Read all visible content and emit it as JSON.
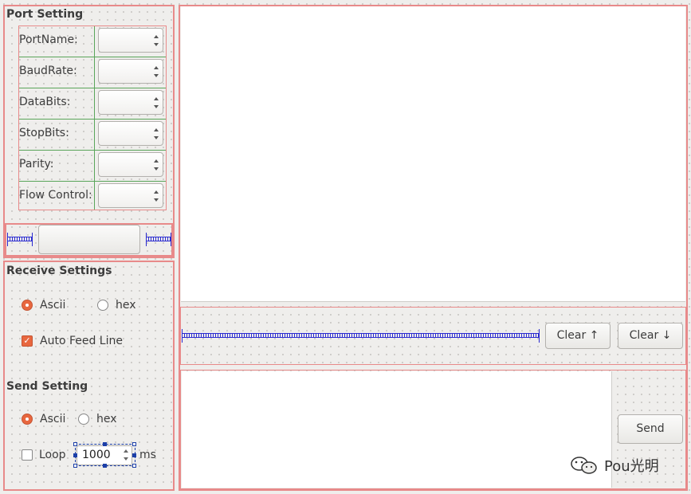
{
  "port_setting": {
    "title": "Port Setting",
    "fields": [
      {
        "label": "PortName:"
      },
      {
        "label": "BaudRate:"
      },
      {
        "label": "DataBits:"
      },
      {
        "label": "StopBits:"
      },
      {
        "label": "Parity:"
      },
      {
        "label": "Flow Control:"
      }
    ],
    "open_button_label": ""
  },
  "receive_settings": {
    "title": "Receive Settings",
    "ascii_label": "Ascii",
    "hex_label": "hex",
    "auto_feed_label": "Auto Feed Line",
    "selected": "Ascii",
    "auto_feed_checked": true
  },
  "send_setting": {
    "title": "Send Setting",
    "ascii_label": "Ascii",
    "hex_label": "hex",
    "loop_label": "Loop",
    "loop_checked": false,
    "interval_value": "1000",
    "interval_unit": "ms",
    "selected": "Ascii"
  },
  "receive_area": {
    "text": ""
  },
  "toolbar": {
    "clear_up_label": "Clear ↑",
    "clear_down_label": "Clear ↓"
  },
  "send_area": {
    "text": "",
    "send_label": "Send"
  },
  "watermark": {
    "text": "Pou光明"
  },
  "colors": {
    "accent": "#e8673f",
    "layout_border": "#e88a8a",
    "grid_border": "#5aa55a",
    "spacer": "#2a2ad0"
  }
}
